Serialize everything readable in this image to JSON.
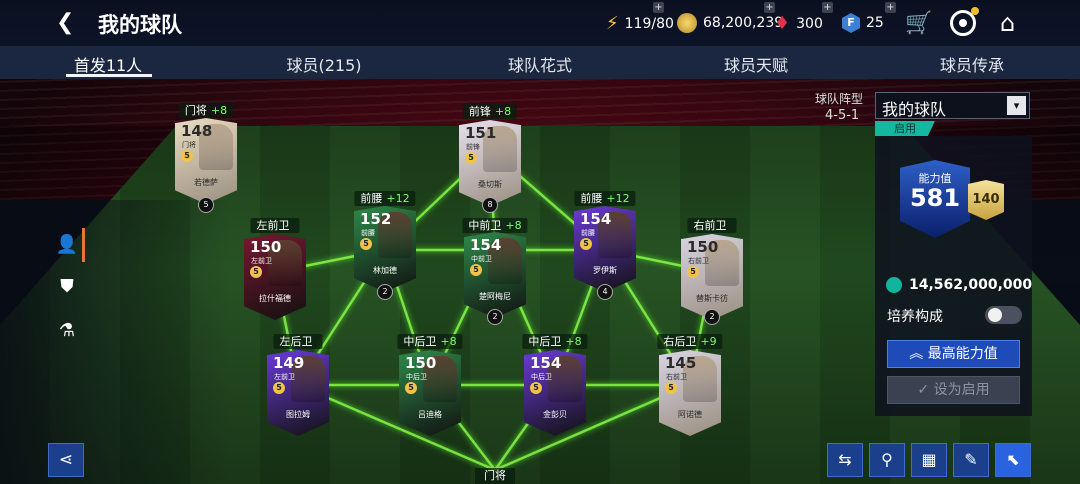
{
  "header": {
    "back_icon": "back-arrow-icon",
    "title": "我的球队"
  },
  "resources": {
    "energy": "119/80",
    "coins": "68,200,239",
    "gems": "300",
    "tokens": "25"
  },
  "tabs": [
    "首发11人",
    "球员(215)",
    "球队花式",
    "球员天赋",
    "球员传承"
  ],
  "players": [
    {
      "label": "门将",
      "bonus": "+8",
      "ovr": "148",
      "pos": "门将",
      "name": "若德萨",
      "level": "5",
      "color": "#e9dcc2"
    },
    {
      "label": "前锋",
      "bonus": "+8",
      "ovr": "151",
      "pos": "前锋",
      "name": "桑切斯",
      "level": "8",
      "color": "#e6e0ee"
    },
    {
      "label": "前腰",
      "bonus": "+12",
      "ovr": "152",
      "pos": "前腰",
      "name": "林加德",
      "level": "2",
      "color": "#2e8a4a"
    },
    {
      "label": "中前卫",
      "bonus": "+8",
      "ovr": "154",
      "pos": "中前卫",
      "name": "楚阿梅尼",
      "level": "2",
      "color": "#2e8a4a"
    },
    {
      "label": "前腰",
      "bonus": "+12",
      "ovr": "154",
      "pos": "前腰",
      "name": "罗伊斯",
      "level": "4",
      "color": "#6b3bd8"
    },
    {
      "label": "左前卫",
      "bonus": "",
      "ovr": "150",
      "pos": "左前卫",
      "name": "拉什福德",
      "level": "",
      "color": "#7a1630"
    },
    {
      "label": "右前卫",
      "bonus": "",
      "ovr": "150",
      "pos": "右前卫",
      "name": "替斯卡彷",
      "level": "2",
      "color": "#d9d4e4"
    },
    {
      "label": "左后卫",
      "bonus": "",
      "ovr": "149",
      "pos": "左前卫",
      "name": "图拉姆",
      "level": "",
      "color": "#6b3bd8"
    },
    {
      "label": "中后卫",
      "bonus": "+8",
      "ovr": "150",
      "pos": "中后卫",
      "name": "吕迪格",
      "level": "",
      "color": "#2e8a4a"
    },
    {
      "label": "中后卫",
      "bonus": "+8",
      "ovr": "154",
      "pos": "中后卫",
      "name": "金彭贝",
      "level": "",
      "color": "#6b3bd8"
    },
    {
      "label": "右后卫",
      "bonus": "+9",
      "ovr": "145",
      "pos": "右前卫",
      "name": "阿诺德",
      "level": "",
      "color": "#d9d4e4"
    }
  ],
  "formation": {
    "label": "球队阵型",
    "value": "4-5-1"
  },
  "team_select": {
    "value": "我的球队",
    "status": "启用"
  },
  "power": {
    "label": "能力值",
    "value": "581",
    "sub": "140"
  },
  "coins_value": "14,562,000,000",
  "train_label": "培养构成",
  "buttons": {
    "max": "最高能力值",
    "enable": "设为启用"
  },
  "gk_bottom": "门将",
  "colors": {
    "accent": "#1e4bb8",
    "teal": "#14b7a0",
    "line_green": "#8cff4a"
  }
}
